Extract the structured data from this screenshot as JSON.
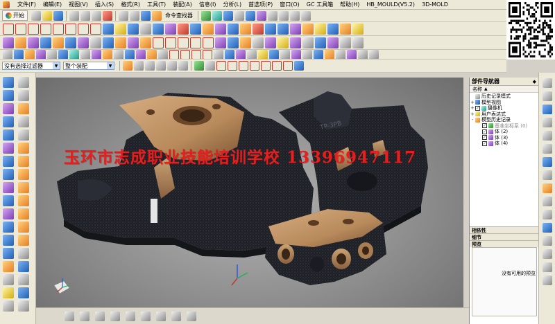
{
  "menubar": {
    "items": [
      "文件(F)",
      "编辑(E)",
      "视图(V)",
      "插入(S)",
      "格式(R)",
      "工具(T)",
      "装配(A)",
      "信息(I)",
      "分析(L)",
      "首选项(P)",
      "窗口(O)",
      "GC 工具箱",
      "帮助(H)",
      "HB_MOULD(V5.2)",
      "3D-MOLD"
    ]
  },
  "toolbar": {
    "start_label": "开始",
    "command_finder_label": "命令查找器"
  },
  "filters": {
    "selection_filter": "没有选择过滤器",
    "assembly_scope": "整个装配"
  },
  "watermark": "玉环市志成职业技能培训学校 13396947117",
  "navigator": {
    "title": "部件导航器",
    "column_header": "名称",
    "items": [
      {
        "label": "历史记录模式",
        "expand": "",
        "check": false
      },
      {
        "label": "模型视图",
        "expand": "+",
        "check": false
      },
      {
        "label": "摄像机",
        "expand": "+",
        "check": true
      },
      {
        "label": "用户表达式",
        "expand": "+",
        "check": false
      },
      {
        "label": "模型历史记录",
        "expand": "-",
        "check": false
      },
      {
        "label": "基准坐标系 (0)",
        "expand": "",
        "check": true,
        "muted": true
      },
      {
        "label": "体 (2)",
        "expand": "",
        "check": true
      },
      {
        "label": "体 (3)",
        "expand": "",
        "check": true
      },
      {
        "label": "体 (4)",
        "expand": "",
        "check": true
      }
    ],
    "dependencies_label": "相依性",
    "details_label": "细节",
    "preview_label": "预览",
    "no_preview_text": "没有可用的预览"
  },
  "colors": {
    "casting_dark": "#1e2026",
    "casting_bronze": "#b88a5c",
    "watermark": "#e32020",
    "viewport_bg": "#9a9a9a"
  }
}
